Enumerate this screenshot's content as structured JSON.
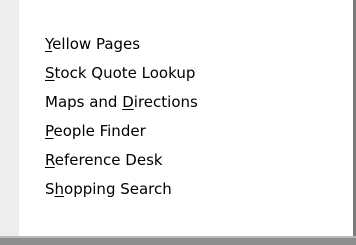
{
  "menu": {
    "items": [
      {
        "before": "",
        "key": "Y",
        "after": "ellow Pages"
      },
      {
        "before": "",
        "key": "S",
        "after": "tock Quote Lookup"
      },
      {
        "before": "Maps and ",
        "key": "D",
        "after": "irections"
      },
      {
        "before": "",
        "key": "P",
        "after": "eople Finder"
      },
      {
        "before": "",
        "key": "R",
        "after": "eference Desk"
      },
      {
        "before": "S",
        "key": "h",
        "after": "opping Search"
      }
    ]
  }
}
